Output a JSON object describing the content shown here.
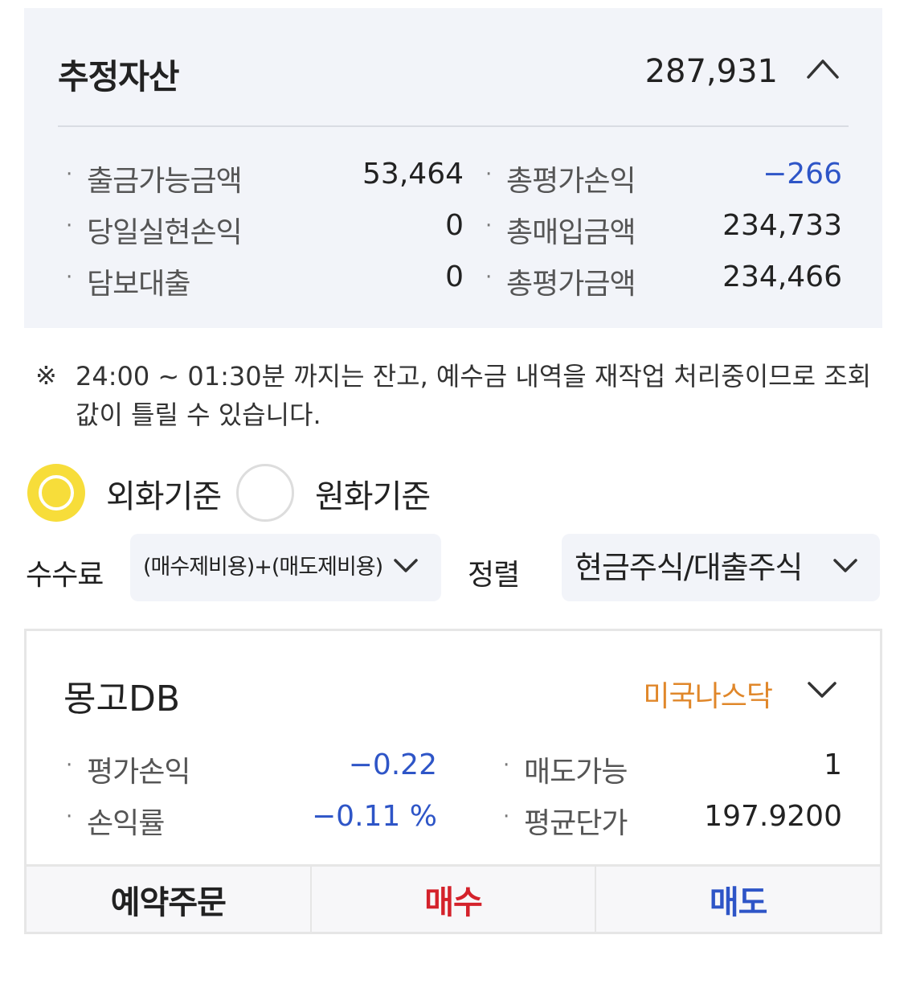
{
  "summary": {
    "title": "추정자산",
    "total": "287,931",
    "collapse_icon": "chevron-up-icon",
    "left_items": [
      {
        "label": "출금가능금액",
        "value": "53,464"
      },
      {
        "label": "당일실현손익",
        "value": "0"
      },
      {
        "label": "담보대출",
        "value": "0"
      }
    ],
    "right_items": [
      {
        "label": "총평가손익",
        "value": "−266"
      },
      {
        "label": "총매입금액",
        "value": "234,733"
      },
      {
        "label": "총평가금액",
        "value": "234,466"
      }
    ],
    "bullet": "·"
  },
  "notice": {
    "mark": "※",
    "text": "24:00 ~ 01:30분 까지는 잔고, 예수금 내역을 재작업 처리중이므로 조회값이 틀릴 수 있습니다."
  },
  "currency": {
    "options": [
      "외화기준",
      "원화기준"
    ],
    "selected": "외화기준"
  },
  "filters": {
    "fee_label": "수수료",
    "fee_value": "(매수제비용)+(매도제비용)",
    "sort_label": "정렬",
    "sort_value": "현금주식/대출주식"
  },
  "stock": {
    "name": "몽고DB",
    "market": "미국나스닥",
    "left_items": [
      {
        "label": "평가손익",
        "value": "−0.22"
      },
      {
        "label": "손익률",
        "value": "−0.11 %"
      }
    ],
    "right_items": [
      {
        "label": "매도가능",
        "value": "1"
      },
      {
        "label": "평균단가",
        "value": "197.9200"
      }
    ],
    "actions": {
      "reserve": "예약주문",
      "buy": "매수",
      "sell": "매도"
    }
  },
  "colors": {
    "negative": "#2e55c7",
    "buy": "#d4222b",
    "sell": "#2e55c7",
    "market": "#e0872a",
    "radio_selected": "#f7dd3a",
    "card_bg": "#f2f4f9"
  }
}
